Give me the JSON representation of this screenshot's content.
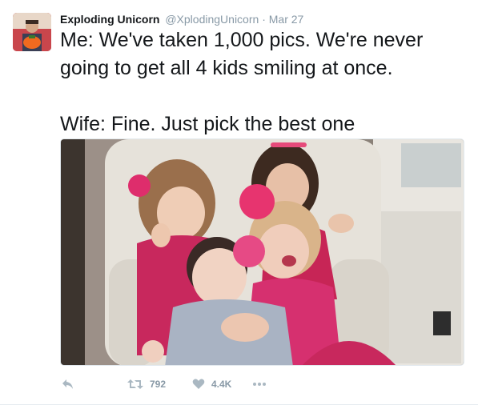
{
  "author": {
    "name": "Exploding Unicorn",
    "handle": "@XplodingUnicorn",
    "separator": "·",
    "time": "Mar 27"
  },
  "tweet": {
    "line1": "Me: We've taken 1,000 pics. We're never going to get all 4 kids smiling at once.",
    "line2": "Wife: Fine. Just pick the best one"
  },
  "actions": {
    "reply_icon": "reply-icon",
    "retweet_icon": "retweet-icon",
    "retweet_count": "792",
    "like_icon": "heart-icon",
    "like_count": "4.4K",
    "more_icon": "more-icon"
  },
  "colors": {
    "text": "#14171a",
    "muted": "#8899a6",
    "border": "#e6ecf0",
    "pink_dress": "#d6306f"
  }
}
